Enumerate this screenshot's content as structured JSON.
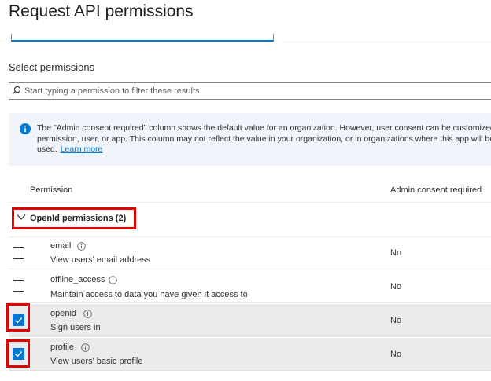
{
  "page": {
    "title": "Request API permissions"
  },
  "section": {
    "select_label": "Select permissions"
  },
  "search": {
    "placeholder": "Start typing a permission to filter these results"
  },
  "info_banner": {
    "text": "The \"Admin consent required\" column shows the default value for an organization. However, user consent can be customized per permission, user, or app. This column may not reflect the value in your organization, or in organizations where this app will be used.",
    "link": "Learn more"
  },
  "table": {
    "headers": {
      "permission": "Permission",
      "admin_consent": "Admin consent required"
    },
    "group": {
      "label": "OpenId permissions (2)",
      "expanded": true
    },
    "rows": [
      {
        "name": "email",
        "description": "View users' email address",
        "admin_consent": "No",
        "checked": false
      },
      {
        "name": "offline_access",
        "description": "Maintain access to data you have given it access to",
        "admin_consent": "No",
        "checked": false
      },
      {
        "name": "openid",
        "description": "Sign users in",
        "admin_consent": "No",
        "checked": true
      },
      {
        "name": "profile",
        "description": "View users' basic profile",
        "admin_consent": "No",
        "checked": true
      }
    ]
  },
  "colors": {
    "accent": "#0078d4",
    "highlight": "#e50000",
    "selected_row": "#edebe9",
    "info_bg": "#f0f4fb"
  }
}
